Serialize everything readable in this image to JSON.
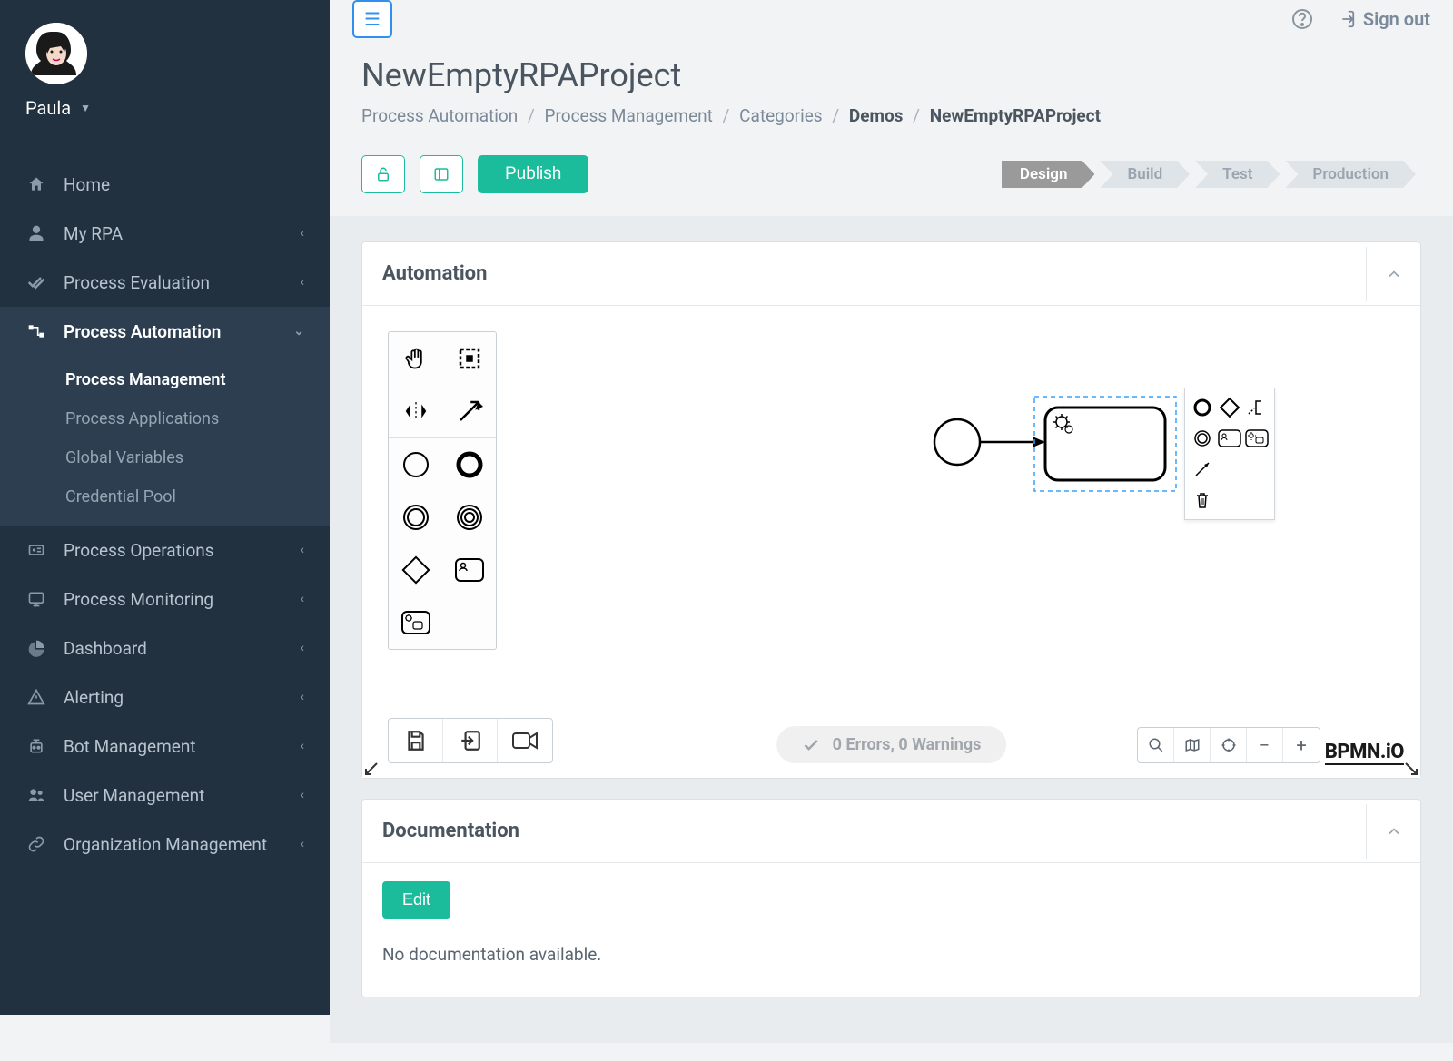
{
  "user": {
    "name": "Paula"
  },
  "topbar": {
    "signout": "Sign out"
  },
  "sidebar": {
    "items": [
      {
        "label": "Home"
      },
      {
        "label": "My RPA"
      },
      {
        "label": "Process Evaluation"
      },
      {
        "label": "Process Automation"
      },
      {
        "label": "Process Operations"
      },
      {
        "label": "Process Monitoring"
      },
      {
        "label": "Dashboard"
      },
      {
        "label": "Alerting"
      },
      {
        "label": "Bot Management"
      },
      {
        "label": "User Management"
      },
      {
        "label": "Organization Management"
      }
    ],
    "subitems": {
      "process_automation": [
        {
          "label": "Process Management"
        },
        {
          "label": "Process Applications"
        },
        {
          "label": "Global Variables"
        },
        {
          "label": "Credential Pool"
        }
      ]
    }
  },
  "page": {
    "title": "NewEmptyRPAProject",
    "breadcrumb": [
      "Process Automation",
      "Process Management",
      "Categories",
      "Demos",
      "NewEmptyRPAProject"
    ],
    "publish_label": "Publish",
    "pipeline": [
      "Design",
      "Build",
      "Test",
      "Production"
    ]
  },
  "automation": {
    "title": "Automation",
    "status": "0 Errors, 0 Warnings",
    "bpmn_logo": "BPMN.iO",
    "palette": {
      "hand": "hand-tool",
      "lasso": "lasso-tool",
      "space": "space-tool",
      "connect": "global-connect-tool",
      "start_event": "start-event",
      "end_event": "end-event",
      "intermediate_throw": "intermediate-throw-event",
      "intermediate_catch": "intermediate-catch-event",
      "gateway": "exclusive-gateway",
      "user_task": "user-task",
      "bot_task": "bot-task"
    }
  },
  "documentation": {
    "title": "Documentation",
    "edit_label": "Edit",
    "empty_text": "No documentation available."
  }
}
